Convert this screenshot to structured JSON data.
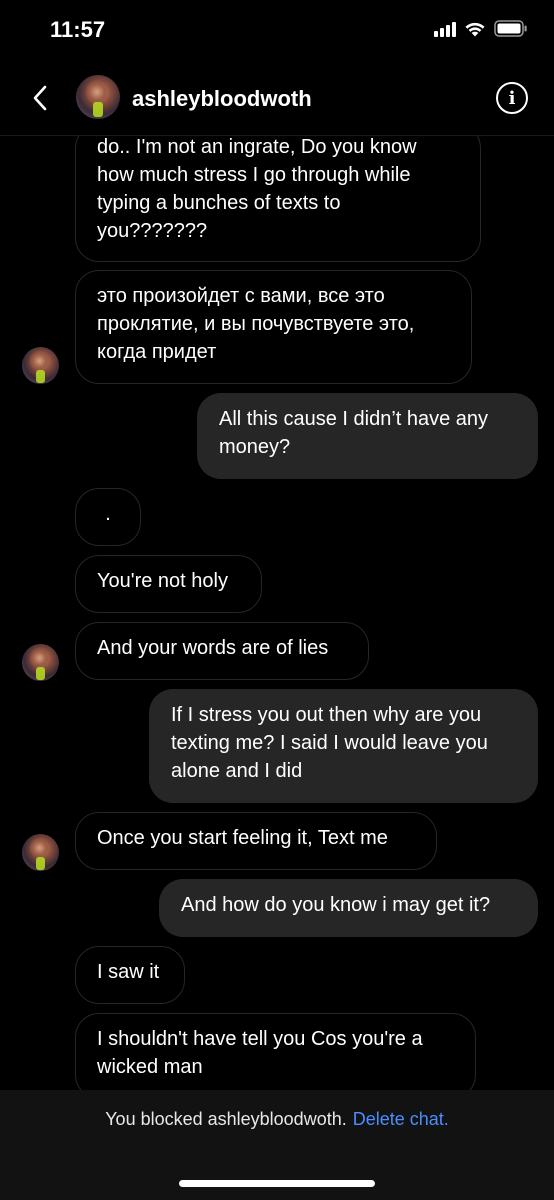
{
  "status_bar": {
    "time": "11:57"
  },
  "header": {
    "username": "ashleybloodwoth",
    "back_icon": "chevron-left-icon",
    "info_icon": "info-icon"
  },
  "messages": [
    {
      "direction": "in",
      "lines": [
        "do.. I'm not an ingrate, Do you know",
        "how much stress I go through while",
        "typing a bunches of texts to",
        "you???????"
      ]
    },
    {
      "direction": "in",
      "lines": [
        "это произойдет с вами, все это",
        "проклятие, и вы почувствуете это,",
        "когда придет"
      ]
    },
    {
      "direction": "out",
      "lines": [
        "All this cause I didn’t have any",
        "money?"
      ]
    },
    {
      "direction": "in",
      "lines": [
        "."
      ]
    },
    {
      "direction": "in",
      "lines": [
        "You're not holy"
      ]
    },
    {
      "direction": "in",
      "lines": [
        "And your words are of lies"
      ]
    },
    {
      "direction": "out",
      "lines": [
        "If I stress you out then why are you",
        "texting me? I said I would leave you",
        "alone and I did"
      ]
    },
    {
      "direction": "in",
      "lines": [
        "Once you start feeling it, Text me"
      ]
    },
    {
      "direction": "out",
      "lines": [
        "And how do you know i may get it?"
      ]
    },
    {
      "direction": "in",
      "lines": [
        "I saw it"
      ]
    },
    {
      "direction": "in",
      "lines": [
        "I shouldn't have tell you Cos you're a",
        "wicked man"
      ]
    }
  ],
  "footer": {
    "blocked_text": "You blocked ashleybloodwoth.",
    "delete_label": "Delete chat."
  },
  "colors": {
    "background": "#000000",
    "outgoing_bubble": "#262626",
    "incoming_border": "#262626",
    "link": "#4c8dff"
  }
}
